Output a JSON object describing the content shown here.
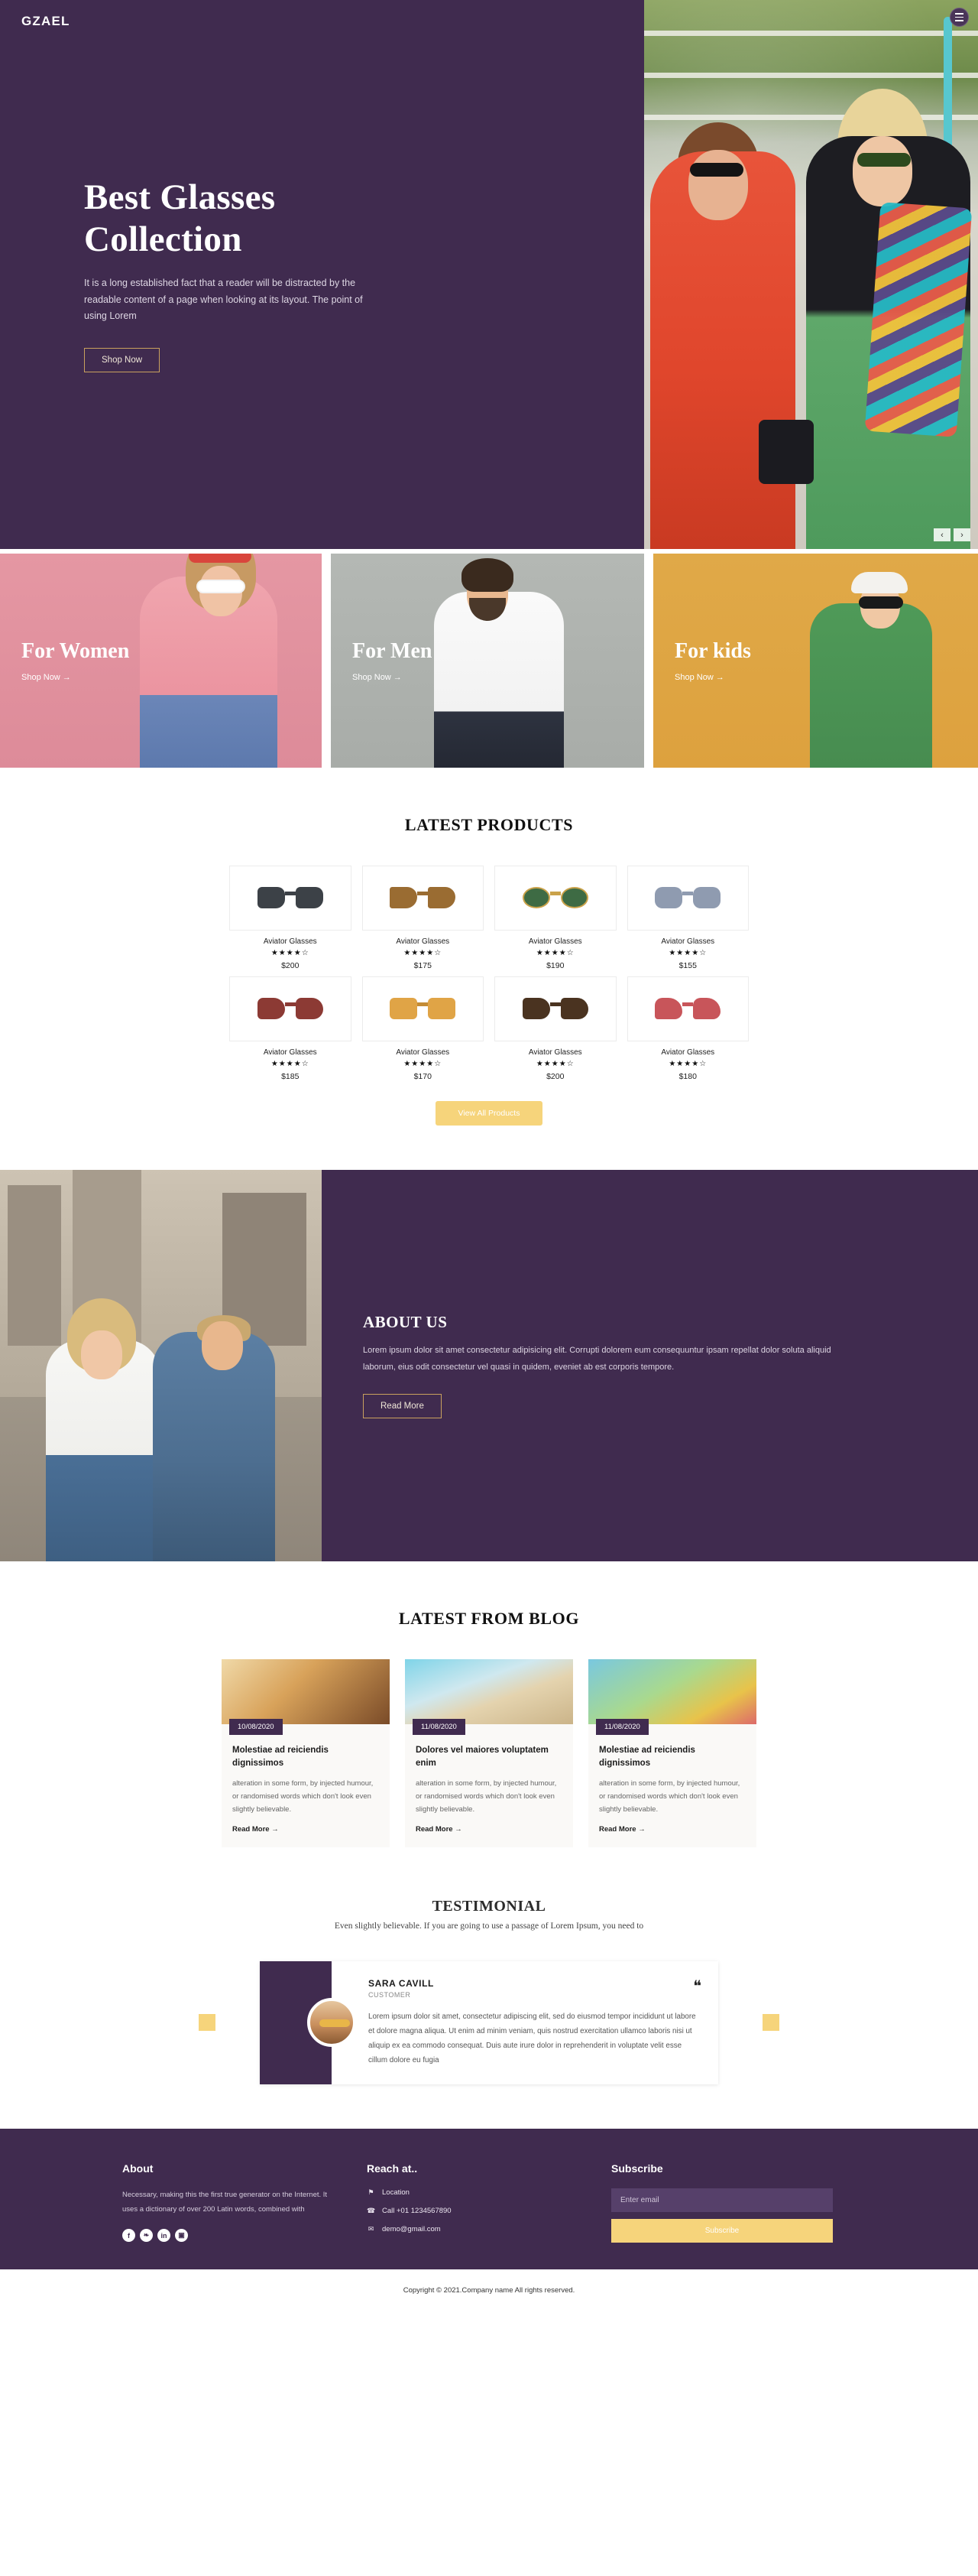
{
  "brand": "GZAEL",
  "hero": {
    "title": "Best Glasses Collection",
    "subtitle": "It is a long established fact that a reader will be distracted by the readable content of a page when looking at its layout. The point of using Lorem",
    "cta": "Shop Now",
    "prev_arrow": "‹",
    "next_arrow": "›"
  },
  "categories": [
    {
      "title": "For Women",
      "link": "Shop Now →"
    },
    {
      "title": "For Men",
      "link": "Shop Now →"
    },
    {
      "title": "For kids",
      "link": "Shop Now →"
    }
  ],
  "products": {
    "heading": "LATEST PRODUCTS",
    "view_all": "View All Products",
    "items": [
      {
        "name": "Aviator Glasses",
        "stars": "★★★★☆",
        "price": "$200"
      },
      {
        "name": "Aviator Glasses",
        "stars": "★★★★☆",
        "price": "$175"
      },
      {
        "name": "Aviator Glasses",
        "stars": "★★★★☆",
        "price": "$190"
      },
      {
        "name": "Aviator Glasses",
        "stars": "★★★★☆",
        "price": "$155"
      },
      {
        "name": "Aviator Glasses",
        "stars": "★★★★☆",
        "price": "$185"
      },
      {
        "name": "Aviator Glasses",
        "stars": "★★★★☆",
        "price": "$170"
      },
      {
        "name": "Aviator Glasses",
        "stars": "★★★★☆",
        "price": "$200"
      },
      {
        "name": "Aviator Glasses",
        "stars": "★★★★☆",
        "price": "$180"
      }
    ]
  },
  "about": {
    "title": "ABOUT US",
    "body": "Lorem ipsum dolor sit amet consectetur adipisicing elit. Corrupti dolorem eum consequuntur ipsam repellat dolor soluta aliquid laborum, eius odit consectetur vel quasi in quidem, eveniet ab est corporis tempore.",
    "cta": "Read More"
  },
  "blog": {
    "heading": "LATEST FROM BLOG",
    "posts": [
      {
        "date": "10/08/2020",
        "title": "Molestiae ad reiciendis dignissimos",
        "desc": "alteration in some form, by injected humour, or randomised words which don't look even slightly believable.",
        "more": "Read More →"
      },
      {
        "date": "11/08/2020",
        "title": "Dolores vel maiores voluptatem enim",
        "desc": "alteration in some form, by injected humour, or randomised words which don't look even slightly believable.",
        "more": "Read More →"
      },
      {
        "date": "11/08/2020",
        "title": "Molestiae ad reiciendis dignissimos",
        "desc": "alteration in some form, by injected humour, or randomised words which don't look even slightly believable.",
        "more": "Read More →"
      }
    ]
  },
  "testimonial": {
    "heading": "TESTIMONIAL",
    "subheading": "Even slightly believable. If you are going to use a passage of Lorem Ipsum, you need to",
    "name": "SARA CAVILL",
    "role": "CUSTOMER",
    "quote_mark": "❝",
    "text": "Lorem ipsum dolor sit amet, consectetur adipiscing elit, sed do eiusmod tempor incididunt ut labore et dolore magna aliqua. Ut enim ad minim veniam, quis nostrud exercitation ullamco laboris nisi ut aliquip ex ea commodo consequat. Duis aute irure dolor in reprehenderit in voluptate velit esse cillum dolore eu fugia"
  },
  "footer": {
    "about_title": "About",
    "about_body": "Necessary, making this the first true generator on the Internet. It uses a dictionary of over 200 Latin words, combined with",
    "social": [
      {
        "icon": "facebook-icon",
        "glyph": "f"
      },
      {
        "icon": "twitter-icon",
        "glyph": "❧"
      },
      {
        "icon": "linkedin-icon",
        "glyph": "in"
      },
      {
        "icon": "instagram-icon",
        "glyph": "▣"
      }
    ],
    "reach_title": "Reach at..",
    "contacts": [
      {
        "icon": "location-pin-icon",
        "glyph": "⚑",
        "text": "Location"
      },
      {
        "icon": "phone-icon",
        "glyph": "☎",
        "text": "Call +01 1234567890"
      },
      {
        "icon": "mail-icon",
        "glyph": "✉",
        "text": "demo@gmail.com"
      }
    ],
    "subscribe_title": "Subscribe",
    "email_placeholder": "Enter email",
    "subscribe_btn": "Subscribe",
    "copyright": "Copyright © 2021.Company name All rights reserved."
  },
  "colors": {
    "primary_purple": "#402b4f",
    "accent_yellow": "#f6d47b",
    "gold": "#c9a15e"
  }
}
